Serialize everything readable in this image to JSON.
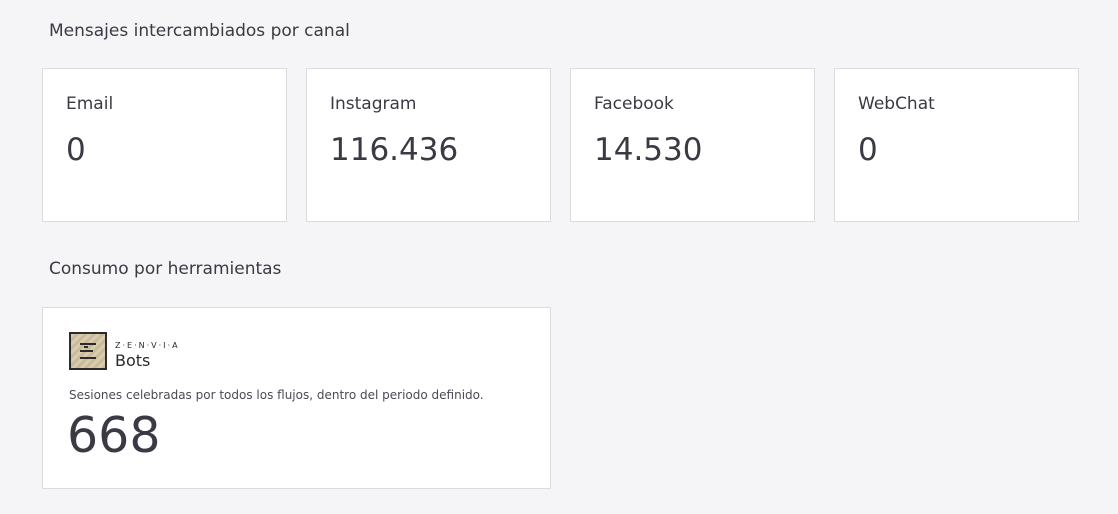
{
  "sections": {
    "channels_title": "Mensajes intercambiados por canal",
    "tools_title": "Consumo por herramientas"
  },
  "channels": [
    {
      "label": "Email",
      "value": "0"
    },
    {
      "label": "Instagram",
      "value": "116.436"
    },
    {
      "label": "Facebook",
      "value": "14.530"
    },
    {
      "label": "WebChat",
      "value": "0"
    }
  ],
  "tools": {
    "bots": {
      "logo_icon": "zenvia-bots-logo-icon",
      "brand": "Z·E·N·V·I·A",
      "product": "Bots",
      "description": "Sesiones celebradas por todos los flujos, dentro del periodo definido.",
      "value": "668"
    }
  }
}
